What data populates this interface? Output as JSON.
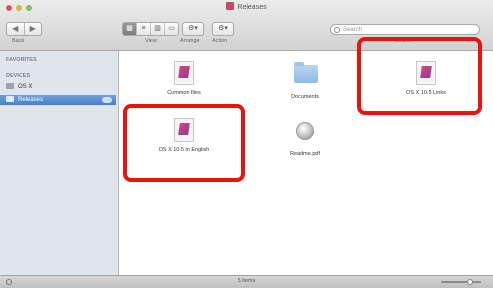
{
  "window": {
    "title": "Releases"
  },
  "toolbar": {
    "back_label": "◀",
    "forward_label": "▶",
    "back_fwd_caption": "Back",
    "view_buttons": [
      "▦",
      "≡",
      "▥",
      "▭"
    ],
    "view_caption": "View",
    "arrange_label": "⚙▾",
    "arrange_caption": "Arrange",
    "action_label": "⚙▾",
    "action_caption": "Action",
    "search_placeholder": "Search",
    "search_caption": "Search"
  },
  "sidebar": {
    "sections": [
      {
        "heading": "FAVORITES"
      },
      {
        "heading": "DEVICES"
      }
    ],
    "items": [
      {
        "label": "OS X",
        "selected": false
      },
      {
        "label": "Releases",
        "selected": true
      }
    ]
  },
  "files": [
    {
      "name": "Common files",
      "kind": "doc"
    },
    {
      "name": "Documents",
      "kind": "folder"
    },
    {
      "name": "OS X 10.5 Links",
      "kind": "doc",
      "highlighted": true
    },
    {
      "name": "OS X 10.5 in English",
      "kind": "doc",
      "highlighted": true
    },
    {
      "name": "Readme.pdf",
      "kind": "package"
    }
  ],
  "status": {
    "text": "5 items"
  },
  "colors": {
    "highlight": "#e8150f",
    "selection": "#4a7fc8"
  }
}
